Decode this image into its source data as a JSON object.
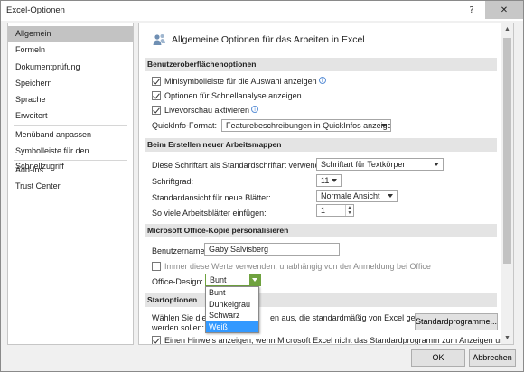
{
  "window": {
    "title": "Excel-Optionen",
    "help": "?",
    "close": "✕"
  },
  "sidebar": {
    "items": [
      {
        "label": "Allgemein"
      },
      {
        "label": "Formeln"
      },
      {
        "label": "Dokumentprüfung"
      },
      {
        "label": "Speichern"
      },
      {
        "label": "Sprache"
      },
      {
        "label": "Erweitert"
      },
      {
        "label": "Menüband anpassen"
      },
      {
        "label": "Symbolleiste für den Schnellzugriff"
      },
      {
        "label": "Add-Ins"
      },
      {
        "label": "Trust Center"
      }
    ]
  },
  "header": {
    "title": "Allgemeine Optionen für das Arbeiten in Excel"
  },
  "sections": {
    "ui": "Benutzeroberflächenoptionen",
    "new_wb": "Beim Erstellen neuer Arbeitsmappen",
    "personalize": "Microsoft Office-Kopie personalisieren",
    "start": "Startoptionen"
  },
  "ui_options": {
    "minitoolbar": "Minisymbolleiste für die Auswahl anzeigen",
    "quickanalysis": "Optionen für Schnellanalyse anzeigen",
    "livepreview": "Livevorschau aktivieren",
    "quickinfo_label": "QuickInfo-Format:",
    "quickinfo_value": "Featurebeschreibungen in QuickInfos anzeigen",
    "info_glyph": "i"
  },
  "new_workbook": {
    "font_label": "Diese Schriftart als Standardschriftart verwenden:",
    "font_value": "Schriftart für Textkörper",
    "size_label": "Schriftgrad:",
    "size_value": "11",
    "view_label": "Standardansicht für neue Blätter:",
    "view_value": "Normale Ansicht",
    "sheets_label": "So viele Arbeitsblätter einfügen:",
    "sheets_value": "1"
  },
  "personalize": {
    "username_label": "Benutzername:",
    "username_value": "Gaby Salvisberg",
    "always_label": "Immer diese Werte verwenden, unabhängig von der Anmeldung bei Office",
    "design_label": "Office-Design:",
    "design_value": "Bunt",
    "design_options": [
      "Bunt",
      "Dunkelgrau",
      "Schwarz",
      "Weiß"
    ],
    "design_highlighted": "Weiß"
  },
  "start_options": {
    "line1_start": "Wählen Sie die E",
    "line1_end": "en aus, die standardmäßig von Excel geöffnet",
    "line2": "werden sollen:",
    "default_programs_button": "Standardprogramme...",
    "notify_label": "Einen Hinweis anzeigen, wenn Microsoft Excel nicht das Standardprogramm zum Anzeigen und"
  },
  "footer": {
    "ok": "OK",
    "cancel": "Abbrechen"
  }
}
